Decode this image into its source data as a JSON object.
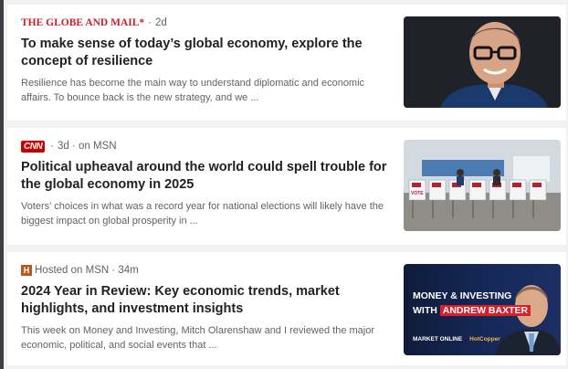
{
  "articles": [
    {
      "source": "THE GLOBE AND MAIL*",
      "meta": "2d",
      "headline": "To make sense of today’s global economy, explore the concept of resilience",
      "snippet": "Resilience has become the main way to understand diplomatic and economic affairs. To bounce back is the new strategy, and we ..."
    },
    {
      "source": "CNN",
      "meta": "3d · on MSN",
      "headline": "Political upheaval around the world could spell trouble for the global economy in 2025",
      "snippet": "Voters’ choices in what was a record year for national elections will likely have the biggest impact on global prosperity in ...",
      "thumb_vote_label": "VOTE"
    },
    {
      "source": "H",
      "meta": "Hosted on MSN · 34m",
      "headline": "2024 Year in Review: Key economic trends, market highlights, and investment insights",
      "snippet": "This week on Money and Investing, Mitch Olarenshaw and I reviewed the major economic, political, and social events that ...",
      "thumb_line1": "MONEY & INVESTING",
      "thumb_line2_prefix": "WITH",
      "thumb_line2_name": "ANDREW BAXTER",
      "thumb_footer_a": "MARKET ONLINE",
      "thumb_footer_b": "HotCopper"
    }
  ],
  "colors": {
    "globe_red": "#c7202f",
    "cnn_red": "#cc0000",
    "headline": "#202124",
    "meta": "#5f6368"
  }
}
